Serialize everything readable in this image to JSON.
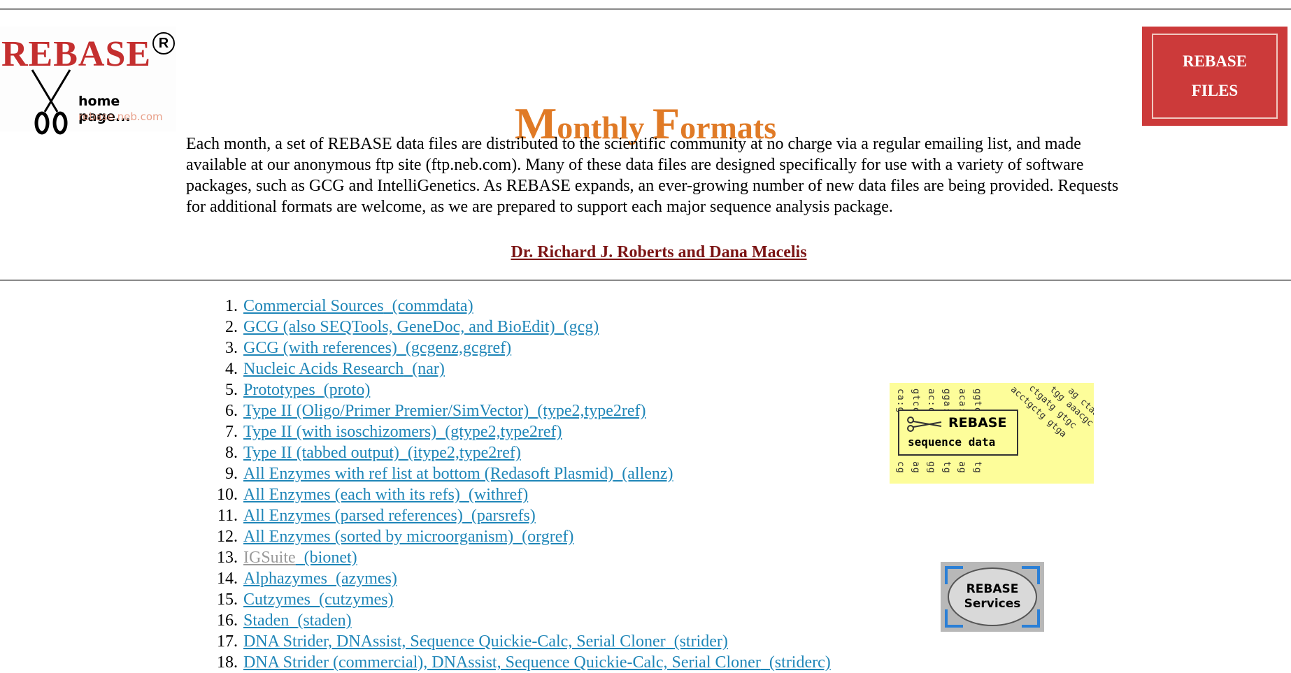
{
  "logo": {
    "brand": "REBASE",
    "registered": "R",
    "home_text": "home page...",
    "url": "rebase.neb.com"
  },
  "files_button": {
    "line1": "REBASE",
    "line2": "FILES"
  },
  "title": {
    "cap1": "M",
    "rest1": "onthly ",
    "cap2": "F",
    "rest2": "ormats"
  },
  "intro": "Each month, a set of REBASE data files are distributed to the scientific community at no charge via a regular emailing list, and made available at our anonymous ftp site (ftp.neb.com). Many of these data files are designed specifically for use with a variety of software packages, such as GCG and IntelliGenetics. As REBASE expands, an ever-growing number of new data files are being provided. Requests for additional formats are welcome, as we are prepared to support each major sequence analysis package.",
  "authors": "Dr. Richard J. Roberts and Dana Macelis",
  "formats": [
    {
      "num": "1.",
      "name": "Commercial Sources",
      "code": "(commdata)"
    },
    {
      "num": "2.",
      "name": "GCG (also SEQTools, GeneDoc, and BioEdit)",
      "code": "(gcg)"
    },
    {
      "num": "3.",
      "name": "GCG (with references)",
      "code": "(gcgenz,gcgref)"
    },
    {
      "num": "4.",
      "name": "Nucleic Acids Research",
      "code": "(nar)"
    },
    {
      "num": "5.",
      "name": "Prototypes",
      "code": "(proto)"
    },
    {
      "num": "6.",
      "name": "Type II (Oligo/Primer Premier/SimVector)",
      "code": "(type2,type2ref)"
    },
    {
      "num": "7.",
      "name": "Type II (with isoschizomers)",
      "code": "(gtype2,type2ref)"
    },
    {
      "num": "8.",
      "name": "Type II (tabbed output)",
      "code": "(itype2,type2ref)"
    },
    {
      "num": "9.",
      "name": "All Enzymes with ref list at bottom (Redasoft Plasmid)",
      "code": "(allenz)"
    },
    {
      "num": "10.",
      "name": "All Enzymes (each with its refs)",
      "code": "(withref)"
    },
    {
      "num": "11.",
      "name": "All Enzymes (parsed references)",
      "code": "(parsrefs)"
    },
    {
      "num": "12.",
      "name": "All Enzymes (sorted by microorganism)",
      "code": "(orgref)"
    },
    {
      "num": "13.",
      "name": "IGSuite",
      "code": "(bionet)",
      "disabled": true
    },
    {
      "num": "14.",
      "name": "Alphazymes",
      "code": "(azymes)"
    },
    {
      "num": "15.",
      "name": "Cutzymes",
      "code": "(cutzymes)"
    },
    {
      "num": "16.",
      "name": "Staden",
      "code": "(staden)"
    },
    {
      "num": "17.",
      "name": "DNA Strider, DNAssist, Sequence Quickie-Calc, Serial Cloner",
      "code": "(strider)"
    },
    {
      "num": "18.",
      "name": "DNA Strider (commercial), DNAssist, Sequence Quickie-Calc, Serial Cloner",
      "code": "(striderc)"
    }
  ],
  "seq_image": {
    "line1": "REBASE",
    "line2": "sequence data"
  },
  "services_image": {
    "line1": "REBASE",
    "line2": "Services"
  },
  "colors": {
    "title": "#e07a26",
    "link": "#1f86b8",
    "author_link": "#7b1414",
    "files_button_bg": "#cc3a3a",
    "seq_image_bg": "#fdfd9a"
  }
}
